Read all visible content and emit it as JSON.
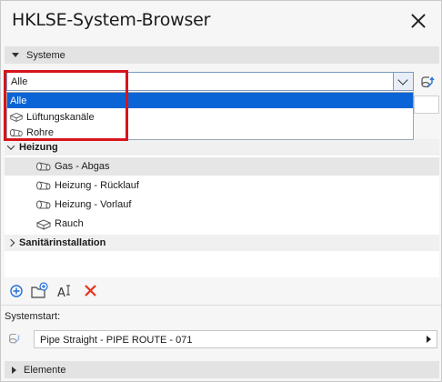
{
  "window": {
    "title": "HKLSE-System-Browser"
  },
  "sections": {
    "systeme": "Systeme",
    "elemente": "Elemente"
  },
  "filter": {
    "selected": "Alle",
    "options": [
      "Alle",
      "Lüftungskanäle",
      "Rohre"
    ]
  },
  "tree": {
    "groups": [
      {
        "label": "Heizung",
        "expanded": true,
        "items": [
          {
            "label": "Gas - Abgas",
            "icon": "pipe-icon"
          },
          {
            "label": "Heizung - Rücklauf",
            "icon": "pipe-icon"
          },
          {
            "label": "Heizung - Vorlauf",
            "icon": "pipe-icon"
          },
          {
            "label": "Rauch",
            "icon": "duct-icon"
          }
        ]
      },
      {
        "label": "Sanitärinstallation",
        "expanded": false,
        "items": []
      }
    ]
  },
  "toolbar": {
    "buttons": [
      "add-system-icon",
      "new-folder-icon",
      "rename-icon",
      "delete-icon"
    ]
  },
  "systemstart": {
    "label": "Systemstart:",
    "value": "Pipe Straight - PIPE ROUTE - 071"
  },
  "colors": {
    "selection": "#0a64d6",
    "highlight_frame": "#d7141b",
    "add_icon": "#1e6fd9",
    "delete_icon": "#e5321c"
  }
}
